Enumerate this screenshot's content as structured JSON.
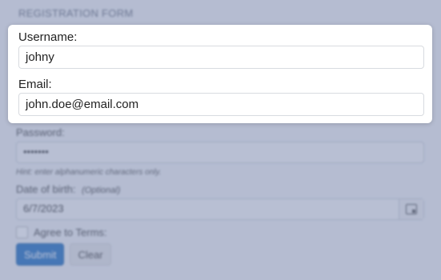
{
  "form": {
    "title": "REGISTRATION FORM",
    "username": {
      "label": "Username:",
      "value": "johny"
    },
    "email": {
      "label": "Email:",
      "value": "john.doe@email.com"
    },
    "password": {
      "label": "Password:",
      "value": "•••••••"
    },
    "password_hint": "Hint: enter alphanumeric characters only.",
    "dob": {
      "label": "Date of birth:",
      "optional": "(Optional)",
      "value": "6/7/2023"
    },
    "terms": {
      "label": "Agree to Terms:"
    },
    "buttons": {
      "submit": "Submit",
      "clear": "Clear"
    }
  }
}
